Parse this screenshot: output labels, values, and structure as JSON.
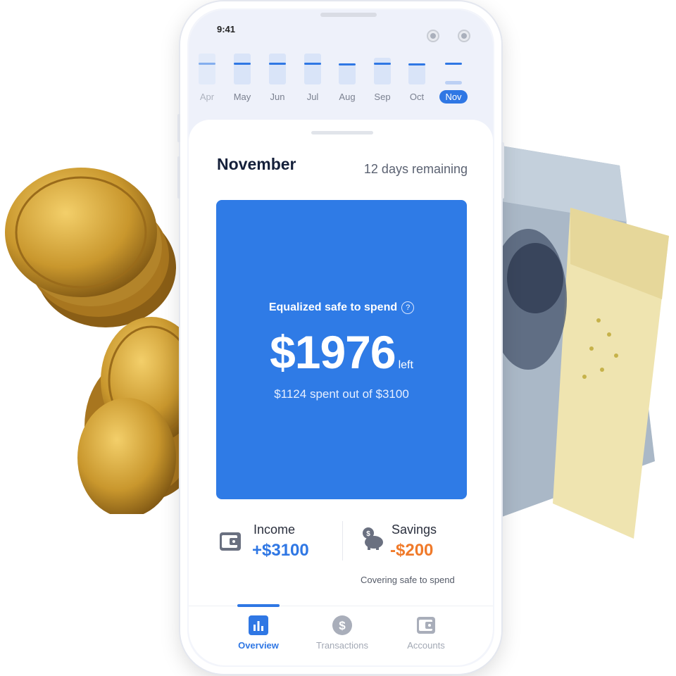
{
  "status": {
    "time": "9:41"
  },
  "months": [
    {
      "label": "Apr",
      "active": false
    },
    {
      "label": "May",
      "active": false
    },
    {
      "label": "Jun",
      "active": false
    },
    {
      "label": "Jul",
      "active": false
    },
    {
      "label": "Aug",
      "active": false
    },
    {
      "label": "Sep",
      "active": false
    },
    {
      "label": "Oct",
      "active": false
    },
    {
      "label": "Nov",
      "active": true
    }
  ],
  "header": {
    "title": "November",
    "remaining": "12 days remaining"
  },
  "hero": {
    "label": "Equalized safe to spend",
    "help_glyph": "?",
    "amount": "$1976",
    "suffix": "left",
    "subtitle": "$1124 spent out of $3100"
  },
  "income": {
    "label": "Income",
    "value": "+$3100"
  },
  "savings": {
    "label": "Savings",
    "value": "-$200",
    "note": "Covering safe to spend"
  },
  "tabs": [
    {
      "label": "Overview",
      "icon": "bar-chart-icon",
      "active": true
    },
    {
      "label": "Transactions",
      "icon": "dollar-icon",
      "active": false
    },
    {
      "label": "Accounts",
      "icon": "wallet-icon",
      "active": false
    }
  ],
  "colors": {
    "accent": "#2f77e4",
    "hero": "#2f7be6",
    "negative": "#f07a2a",
    "title": "#15203a"
  }
}
